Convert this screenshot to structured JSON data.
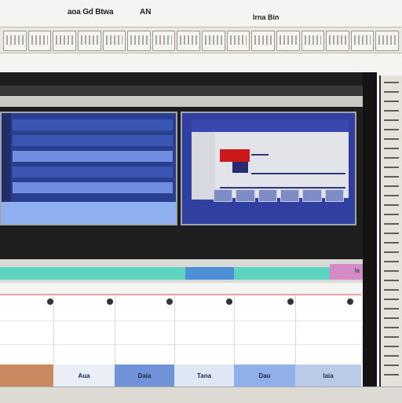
{
  "header": {
    "title_left": "aoa Gd Btwa",
    "title_mid": "AN",
    "title_right": "Irna Bin"
  },
  "timeline": {
    "end_label": "Ia"
  },
  "grid": {
    "cells": [
      "Aua",
      "Daia",
      "Tana",
      "Dau",
      "Iaia"
    ]
  },
  "colors": {
    "timeline": "#5ed3c2",
    "timeline_segment": "#4b8fd6",
    "panel_blue": "#3140a0",
    "accent_red": "#cc1a1a"
  }
}
